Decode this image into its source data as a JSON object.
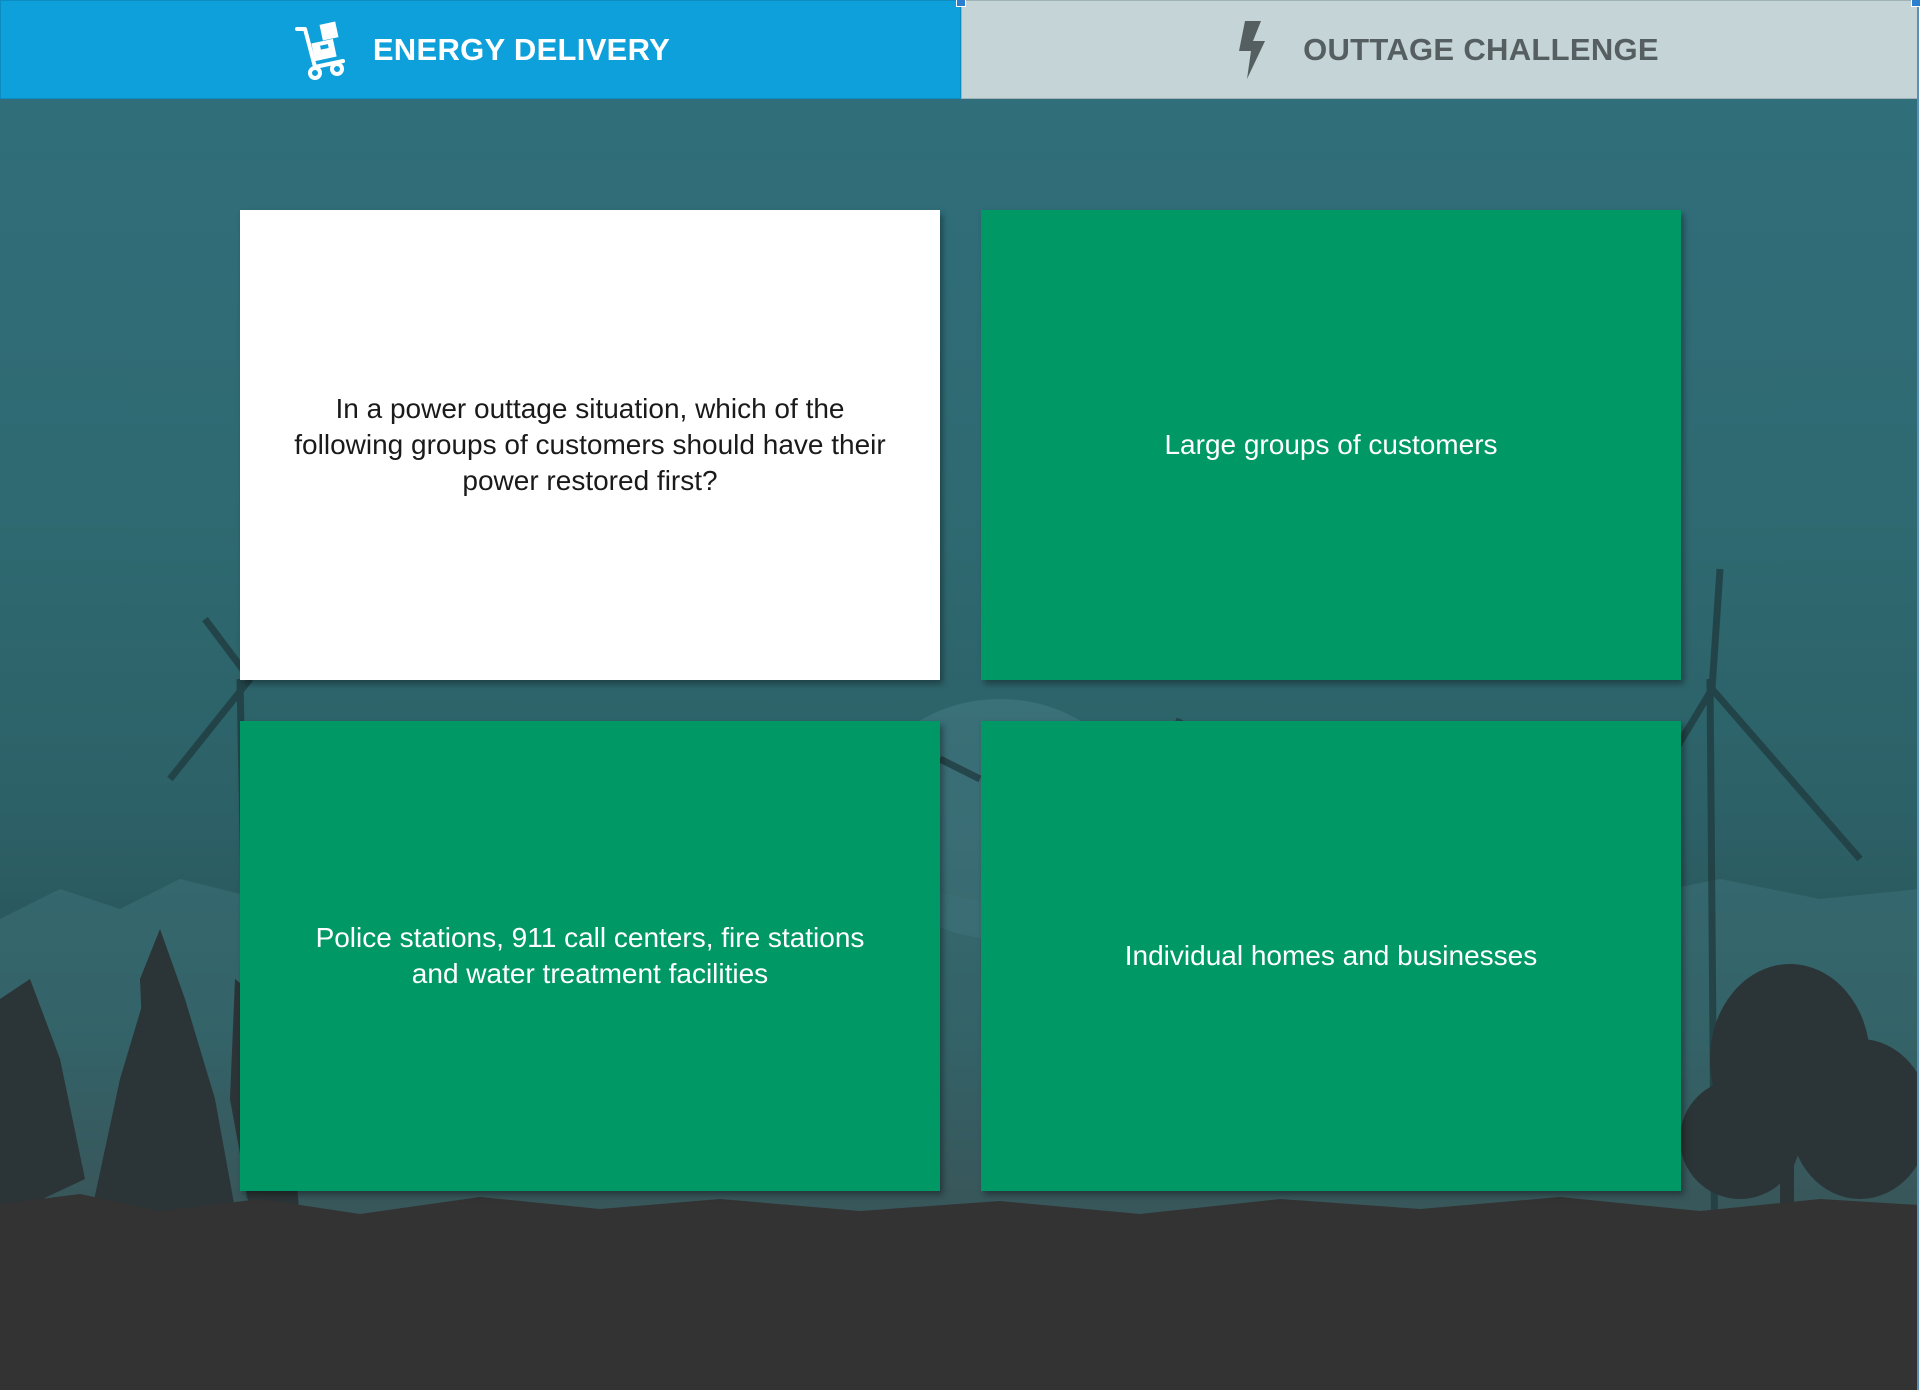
{
  "tabs": [
    {
      "label": "ENERGY DELIVERY",
      "icon": "hand-truck-icon",
      "active": true
    },
    {
      "label": "OUTTAGE CHALLENGE",
      "icon": "lightning-bolt-icon",
      "active": false
    }
  ],
  "question": "In a power outtage situation, which of the following groups of customers should have their power restored first?",
  "answers": [
    "Large groups of customers",
    "Police stations, 911 call centers, fire stations and water treatment facilities",
    "Individual homes and businesses"
  ],
  "colors": {
    "tab_active": "#0ea0da",
    "tab_inactive": "#c5d4d6",
    "answer_card": "#009966",
    "question_card": "#ffffff"
  }
}
